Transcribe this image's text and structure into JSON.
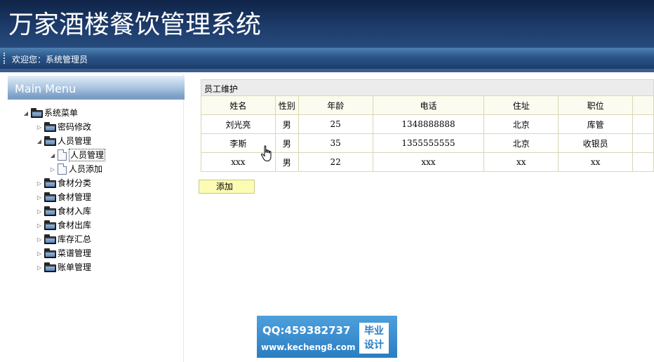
{
  "header": {
    "app_title": "万家酒楼餐饮管理系统",
    "welcome_text": "欢迎您：系统管理员"
  },
  "sidebar": {
    "menu_title": "Main Menu",
    "tree": {
      "root": "系统菜单",
      "items": [
        {
          "label": "密码修改",
          "icon": "folder-icon"
        },
        {
          "label": "人员管理",
          "icon": "folder-icon",
          "expanded": true,
          "children": [
            {
              "label": "人员管理",
              "icon": "document-icon",
              "selected": true
            },
            {
              "label": "人员添加",
              "icon": "document-icon"
            }
          ]
        },
        {
          "label": "食材分类",
          "icon": "folder-icon"
        },
        {
          "label": "食材管理",
          "icon": "folder-icon"
        },
        {
          "label": "食材入库",
          "icon": "folder-icon"
        },
        {
          "label": "食材出库",
          "icon": "folder-icon"
        },
        {
          "label": "库存汇总",
          "icon": "folder-icon"
        },
        {
          "label": "菜谱管理",
          "icon": "folder-icon"
        },
        {
          "label": "账单管理",
          "icon": "folder-icon"
        }
      ]
    }
  },
  "main": {
    "panel_title": "员工维护",
    "table": {
      "columns": [
        "姓名",
        "性别",
        "年龄",
        "电话",
        "住址",
        "职位"
      ],
      "rows": [
        [
          "刘光亮",
          "男",
          "25",
          "1348888888",
          "北京",
          "库管"
        ],
        [
          "李斯",
          "男",
          "35",
          "1355555555",
          "北京",
          "收银员"
        ],
        [
          "xxx",
          "男",
          "22",
          "xxx",
          "xx",
          "xx"
        ]
      ]
    },
    "add_label": "添加"
  },
  "watermark": {
    "qq": "QQ:459382737",
    "url": "www.kecheng8.com",
    "badge_line1": "毕业",
    "badge_line2": "设计"
  },
  "colors": {
    "header_dark": "#1d3b6b",
    "welcome_bar": "#2a5588",
    "table_border": "#d9d6b4",
    "add_button": "#fbfbb4",
    "watermark_blue": "#2b7dc2"
  }
}
